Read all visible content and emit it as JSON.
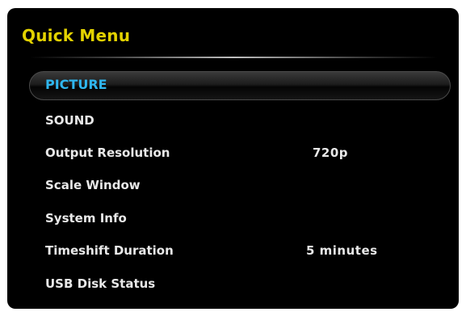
{
  "menu": {
    "title": "Quick Menu",
    "items": [
      {
        "label": "PICTURE",
        "value": ""
      },
      {
        "label": "SOUND",
        "value": ""
      },
      {
        "label": "Output Resolution",
        "value": "720p"
      },
      {
        "label": "Scale Window",
        "value": ""
      },
      {
        "label": "System Info",
        "value": ""
      },
      {
        "label": "Timeshift Duration",
        "value": "5 minutes"
      },
      {
        "label": "USB Disk Status",
        "value": ""
      }
    ],
    "selected_index": 0
  },
  "colors": {
    "title": "#e3d200",
    "selected_text": "#2fb6ee",
    "item_text": "#e8e8e8",
    "background": "#000000"
  }
}
